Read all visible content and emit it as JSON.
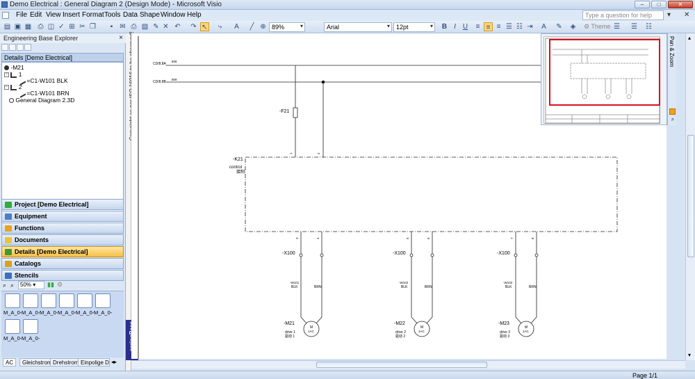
{
  "window": {
    "title": "Demo Electrical : General Diagram 2 (Design Mode) - Microsoft Visio",
    "help_placeholder": "Type a question for help"
  },
  "menu": [
    "File",
    "Edit",
    "View",
    "Insert",
    "Format",
    "Tools",
    "Data",
    "Shape",
    "Window",
    "Help"
  ],
  "toolbar": {
    "zoom": "89%",
    "font": "Arial",
    "font_size": "12pt",
    "theme_label": "Theme"
  },
  "explorer": {
    "title": "Engineering Base Explorer",
    "details_header": "Details [Demo Electrical]",
    "tree": [
      {
        "label": "-M21"
      },
      {
        "label": "1"
      },
      {
        "label": "=C1-W101 BLK"
      },
      {
        "label": "2"
      },
      {
        "label": "=C1-W101 BRN"
      },
      {
        "label": "General Diagram 2.3D"
      }
    ],
    "nav": [
      {
        "label": "Project [Demo Electrical]",
        "icon_color": "#2fae3a"
      },
      {
        "label": "Equipment",
        "icon_color": "#4a7fc8"
      },
      {
        "label": "Functions",
        "icon_color": "#e8a41c"
      },
      {
        "label": "Documents",
        "icon_color": "#e8c43c"
      },
      {
        "label": "Details [Demo Electrical]",
        "icon_color": "#3e9a2e"
      },
      {
        "label": "Catalogs",
        "icon_color": "#d9a21e"
      },
      {
        "label": "Stencils",
        "icon_color": "#3b6fbf"
      }
    ],
    "active_nav": "Details [Demo Electrical]"
  },
  "stencils": {
    "zoom": "50%",
    "items": [
      "M_A_0-",
      "M_A_0-",
      "M_A_0-",
      "M_A_0-",
      "M_A_0-",
      "M_A_0-",
      "M_A_0-",
      "M_A_0-"
    ],
    "tabs": [
      "AC",
      "Gleichstrom",
      "Drehstrom",
      "Einpolige De"
    ]
  },
  "drawing": {
    "copyright": "Copyright as per ISO 16016 to be observed!",
    "eb_brand": "eeringBase",
    "refs": [
      {
        "label": "CD/8.8A",
        "num": "808"
      },
      {
        "label": "CD/8.8B",
        "num": "809"
      }
    ],
    "fuse": "-F21",
    "contactor": "-K21",
    "contactor_desc": "control",
    "contactor_desc_cn": "接制",
    "pins_top": [
      "1",
      "2"
    ],
    "terminal": "-X100",
    "motors": [
      {
        "id": "-M21",
        "cable": "-W101",
        "desc": "drive 1",
        "desc_cn": "驱动 1",
        "pins": [
          "3",
          "4"
        ]
      },
      {
        "id": "-M22",
        "cable": "-W102",
        "desc": "drive 2",
        "desc_cn": "驱动 2",
        "pins": [
          "5",
          "6"
        ]
      },
      {
        "id": "-M23",
        "cable": "-W103",
        "desc": "drive 3",
        "desc_cn": "驱动 3",
        "pins": [
          "7",
          "8"
        ]
      }
    ],
    "cores": [
      "BLK",
      "BRN"
    ],
    "motor_symbol": [
      "M",
      "1AC"
    ]
  },
  "panzoom": {
    "title": "Pan & Zoom"
  },
  "status": {
    "page": "Page 1/1"
  }
}
